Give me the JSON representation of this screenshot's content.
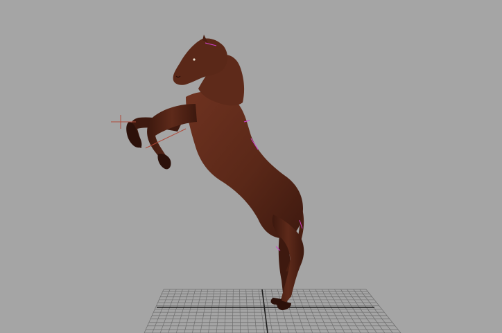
{
  "viewport": {
    "background_color": "#a5a5a5",
    "grid_line_color": "#6e6e6e",
    "grid_axis_color": "#1e1e1e",
    "model_base_color": "#5a2818",
    "model_shadow_color": "#3a170d",
    "model_highlight_color": "#7a3a24",
    "joint_handle_color": "#d040d0",
    "ik_handle_color": "#b04a3a"
  },
  "model": {
    "name": "horse-model",
    "pose": "rearing"
  }
}
